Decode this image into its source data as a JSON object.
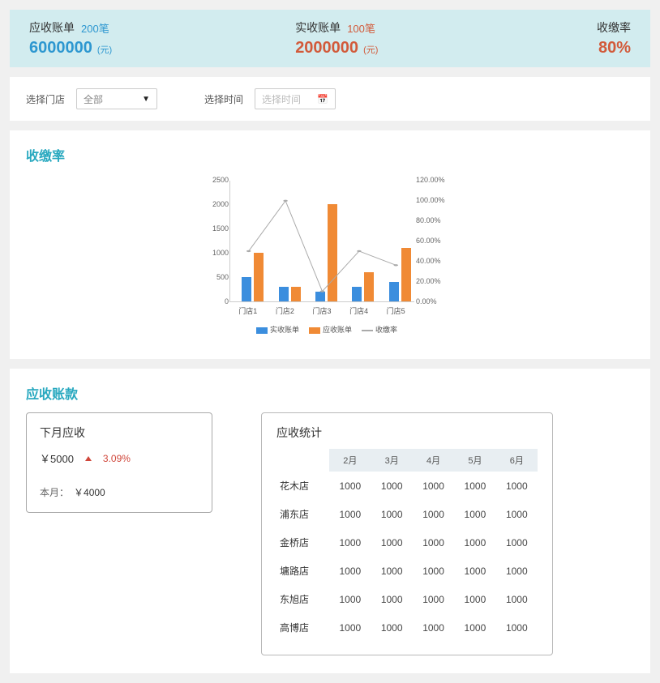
{
  "top": {
    "receivable": {
      "title": "应收账单",
      "count": "200笔",
      "value": "6000000",
      "unit": "(元)"
    },
    "actual": {
      "title": "实收账单",
      "count": "100笔",
      "value": "2000000",
      "unit": "(元)"
    },
    "rate": {
      "title": "收缴率",
      "value": "80%"
    }
  },
  "filters": {
    "store_label": "选择门店",
    "store_value": "全部",
    "time_label": "选择时间",
    "time_placeholder": "选择时间"
  },
  "section_rate_title": "收缴率",
  "section_receivable_title": "应收账款",
  "next_month": {
    "title": "下月应收",
    "amount": "￥5000",
    "pct": "3.09%",
    "this_label": "本月：",
    "this_amount": "￥4000"
  },
  "stats": {
    "title": "应收统计",
    "headers": [
      "",
      "2月",
      "3月",
      "4月",
      "5月",
      "6月"
    ],
    "rows": [
      {
        "name": "花木店",
        "values": [
          "1000",
          "1000",
          "1000",
          "1000",
          "1000"
        ]
      },
      {
        "name": "浦东店",
        "values": [
          "1000",
          "1000",
          "1000",
          "1000",
          "1000"
        ]
      },
      {
        "name": "金桥店",
        "values": [
          "1000",
          "1000",
          "1000",
          "1000",
          "1000"
        ]
      },
      {
        "name": "墉路店",
        "values": [
          "1000",
          "1000",
          "1000",
          "1000",
          "1000"
        ]
      },
      {
        "name": "东旭店",
        "values": [
          "1000",
          "1000",
          "1000",
          "1000",
          "1000"
        ]
      },
      {
        "name": "高博店",
        "values": [
          "1000",
          "1000",
          "1000",
          "1000",
          "1000"
        ]
      }
    ]
  },
  "legend": {
    "actual": "实收账单",
    "receivable": "应收账单",
    "rate": "收缴率"
  },
  "chart_data": {
    "type": "bar",
    "categories": [
      "门店1",
      "门店2",
      "门店3",
      "门店4",
      "门店5"
    ],
    "series": [
      {
        "name": "实收账单",
        "values": [
          500,
          300,
          200,
          300,
          400
        ]
      },
      {
        "name": "应收账单",
        "values": [
          1000,
          300,
          2000,
          600,
          1100
        ]
      }
    ],
    "secondary_series": {
      "name": "收缴率",
      "values": [
        50,
        100,
        10,
        50,
        36
      ]
    },
    "y_left": {
      "min": 0,
      "max": 2500,
      "step": 500
    },
    "y_right": {
      "min": 0,
      "max": 120,
      "step": 20,
      "unit": "%"
    },
    "title": "",
    "xlabel": "",
    "ylabel": ""
  }
}
